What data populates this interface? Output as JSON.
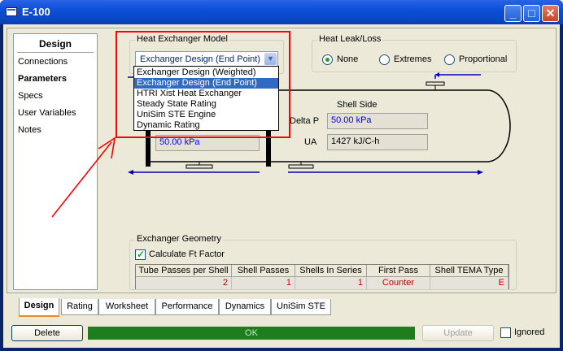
{
  "window": {
    "title": "E-100"
  },
  "nav": {
    "header": "Design",
    "items": [
      "Connections",
      "Parameters",
      "Specs",
      "User Variables",
      "Notes"
    ],
    "selected": "Parameters"
  },
  "heat_exchanger_model": {
    "title": "Heat Exchanger Model",
    "selected": "Exchanger Design (End Point)",
    "options": [
      "Exchanger Design (Weighted)",
      "Exchanger Design (End Point)",
      "HTRI Xist Heat Exchanger",
      "Steady State Rating",
      "UniSim STE Engine",
      "Dynamic Rating"
    ]
  },
  "heat_leak": {
    "title": "Heat Leak/Loss",
    "options": [
      "None",
      "Extremes",
      "Proportional"
    ],
    "selected": "None"
  },
  "tube_side": {
    "delta_p": "50.00 kPa"
  },
  "shell_side": {
    "title": "Shell Side",
    "delta_p_label": "Delta P",
    "delta_p": "50.00 kPa",
    "ua_label": "UA",
    "ua": "1427 kJ/C-h"
  },
  "geometry": {
    "title": "Exchanger Geometry",
    "calc_ft_label": "Calculate Ft Factor",
    "calc_ft_checked": true,
    "columns": [
      "Tube Passes per Shell",
      "Shell Passes",
      "Shells In Series",
      "First Pass",
      "Shell TEMA Type"
    ],
    "values": [
      "2",
      "1",
      "1",
      "Counter",
      "E"
    ]
  },
  "tabs": [
    "Design",
    "Rating",
    "Worksheet",
    "Performance",
    "Dynamics",
    "UniSim STE"
  ],
  "active_tab": "Design",
  "footer": {
    "delete_label": "Delete",
    "status": "OK",
    "update_label": "Update",
    "ignored_label": "Ignored"
  },
  "colors": {
    "annotation": "#ff0000",
    "stream_arrow": "#0000c0",
    "status_ok": "#1e7e1e"
  }
}
